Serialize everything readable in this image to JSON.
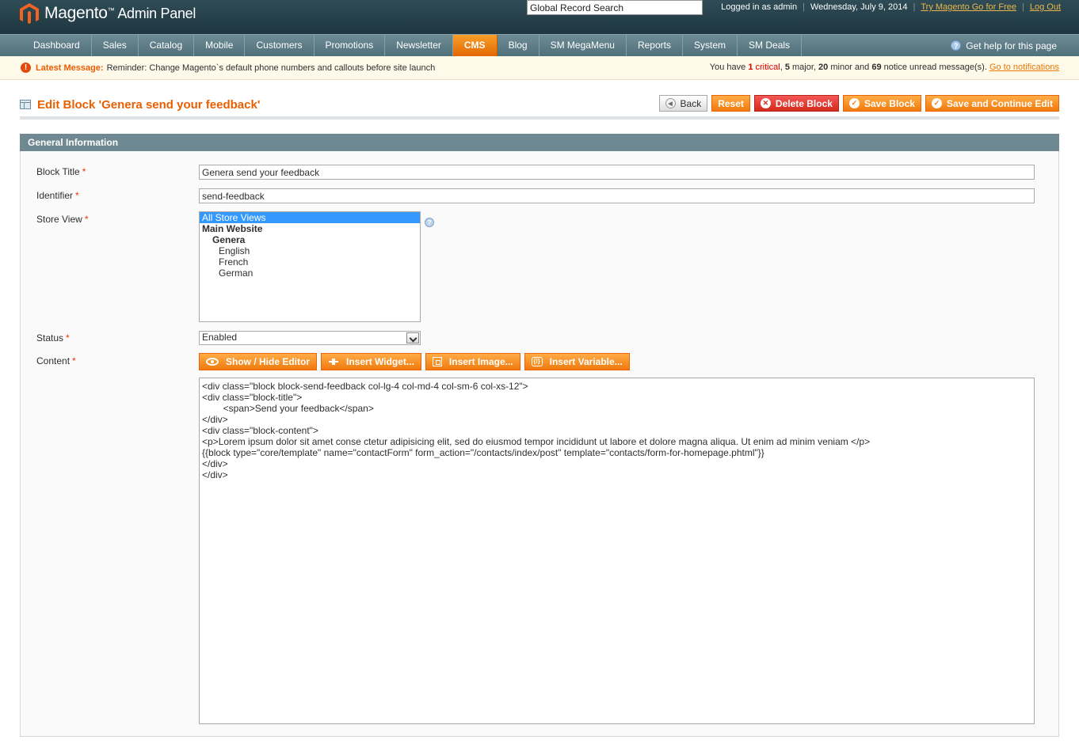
{
  "header": {
    "logo_brand": "Magento",
    "logo_tm": "™",
    "logo_sub": "Admin Panel",
    "search_value": "Global Record Search",
    "logged_in": "Logged in as admin",
    "date": "Wednesday, July 9, 2014",
    "try_link": "Try Magento Go for Free",
    "logout_link": "Log Out",
    "separator": "|"
  },
  "nav": {
    "items": [
      "Dashboard",
      "Sales",
      "Catalog",
      "Mobile",
      "Customers",
      "Promotions",
      "Newsletter",
      "CMS",
      "Blog",
      "SM MegaMenu",
      "Reports",
      "System",
      "SM Deals"
    ],
    "active": "CMS",
    "help": "Get help for this page"
  },
  "message": {
    "label": "Latest Message:",
    "text": "Reminder: Change Magento`s default phone numbers and callouts before site launch",
    "summary_prefix": "You have",
    "critical_count": "1",
    "critical_label": "critical",
    "major_count": "5",
    "major_label": "major,",
    "minor_count": "20",
    "minor_label": "minor and",
    "notice_count": "69",
    "notice_label": "notice unread message(s).",
    "link": "Go to notifications"
  },
  "page": {
    "title": "Edit Block 'Genera send your feedback'",
    "buttons": {
      "back": "Back",
      "reset": "Reset",
      "delete": "Delete Block",
      "save": "Save Block",
      "save_continue": "Save and Continue Edit"
    }
  },
  "form": {
    "section_title": "General Information",
    "required_mark": "*",
    "block_title_label": "Block Title",
    "block_title_value": "Genera send your feedback",
    "identifier_label": "Identifier",
    "identifier_value": "send-feedback",
    "store_view_label": "Store View",
    "store_options": {
      "all": "All Store Views",
      "website": "Main Website",
      "store": "Genera",
      "views": [
        "English",
        "French",
        "German"
      ]
    },
    "status_label": "Status",
    "status_value": "Enabled",
    "content_label": "Content",
    "editor_buttons": {
      "toggle": "Show / Hide Editor",
      "widget": "Insert Widget...",
      "image": "Insert Image...",
      "variable": "Insert Variable..."
    },
    "content_value": "<div class=\"block block-send-feedback col-lg-4 col-md-4 col-sm-6 col-xs-12\">\n<div class=\"block-title\">\n        <span>Send your feedback</span>\n</div>\n<div class=\"block-content\">\n<p>Lorem ipsum dolor sit amet conse ctetur adipisicing elit, sed do eiusmod tempor incididunt ut labore et dolore magna aliqua. Ut enim ad minim veniam </p>\n{{block type=\"core/template\" name=\"contactForm\" form_action=\"/contacts/index/post\" template=\"contacts/form-for-homepage.phtml\"}}\n</div>\n</div>"
  },
  "colors": {
    "accent": "#eb5e00",
    "header_bg": "#2f4c56",
    "nav_bg": "#5f7d87",
    "section_bg": "#6f8992",
    "delete_btn": "#d42a1b"
  },
  "icons": [
    "magento-logo-icon",
    "help-icon",
    "alert-icon",
    "page-icon",
    "back-icon",
    "delete-icon",
    "check-icon",
    "eye-icon",
    "widget-icon",
    "image-icon",
    "variable-icon",
    "chevron-down-icon"
  ]
}
